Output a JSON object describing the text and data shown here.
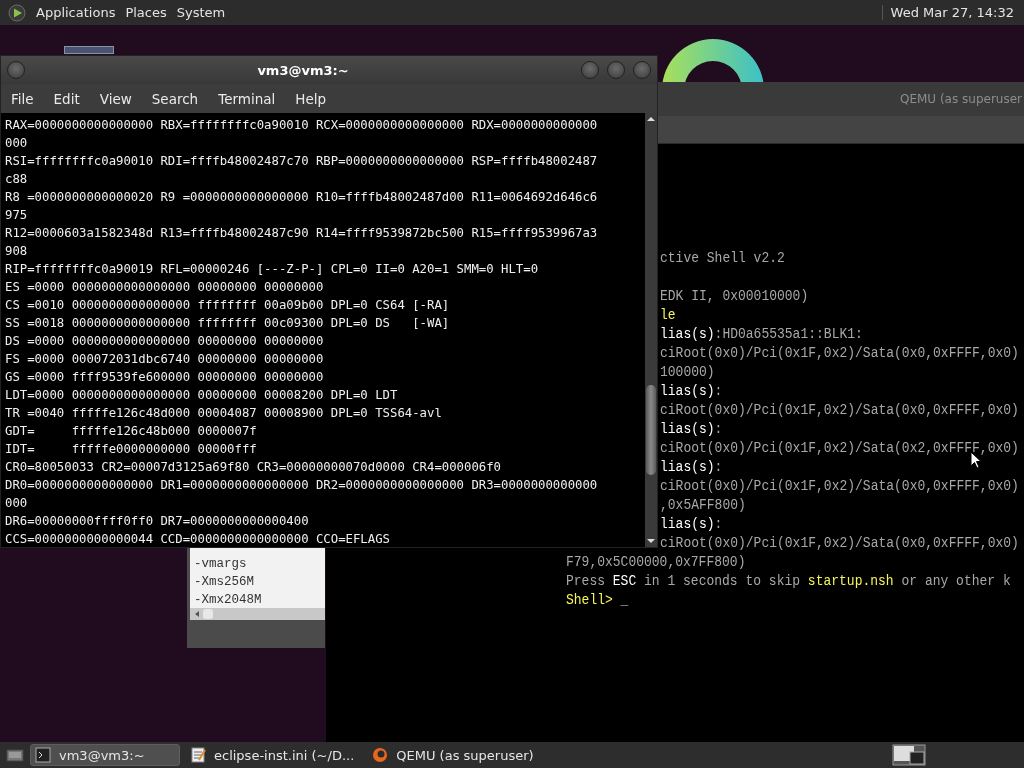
{
  "top_panel": {
    "menus": [
      "Applications",
      "Places",
      "System"
    ],
    "clock": "Wed Mar 27, 14:32"
  },
  "terminal_window": {
    "title": "vm3@vm3:~",
    "menu": [
      "File",
      "Edit",
      "View",
      "Search",
      "Terminal",
      "Help"
    ],
    "lines": [
      "RAX=0000000000000000 RBX=ffffffffc0a90010 RCX=0000000000000000 RDX=0000000000000",
      "000",
      "RSI=ffffffffc0a90010 RDI=ffffb48002487c70 RBP=0000000000000000 RSP=ffffb48002487",
      "c88",
      "R8 =0000000000000020 R9 =0000000000000000 R10=ffffb48002487d00 R11=0064692d646c6",
      "975",
      "R12=0000603a1582348d R13=ffffb48002487c90 R14=ffff9539872bc500 R15=ffff9539967a3",
      "908",
      "RIP=ffffffffc0a90019 RFL=00000246 [---Z-P-] CPL=0 II=0 A20=1 SMM=0 HLT=0",
      "ES =0000 0000000000000000 00000000 00000000",
      "CS =0010 0000000000000000 ffffffff 00a09b00 DPL=0 CS64 [-RA]",
      "SS =0018 0000000000000000 ffffffff 00c09300 DPL=0 DS   [-WA]",
      "DS =0000 0000000000000000 00000000 00000000",
      "FS =0000 000072031dbc6740 00000000 00000000",
      "GS =0000 ffff9539fe600000 00000000 00000000",
      "LDT=0000 0000000000000000 00000000 00008200 DPL=0 LDT",
      "TR =0040 fffffe126c48d000 00004087 00008900 DPL=0 TSS64-avl",
      "GDT=     fffffe126c48b000 0000007f",
      "IDT=     fffffe0000000000 00000fff",
      "CR0=80050033 CR2=00007d3125a69f80 CR3=00000000070d0000 CR4=000006f0",
      "DR0=0000000000000000 DR1=0000000000000000 DR2=0000000000000000 DR3=0000000000000",
      "000",
      "DR6=00000000ffff0ff0 DR7=0000000000000400",
      "CCS=0000000000000044 CCD=0000000000000000 CCO=EFLAGS"
    ]
  },
  "qemu_window": {
    "title": "QEMU (as superuser",
    "lines": [
      {
        "kind": "partial",
        "segments": [
          {
            "kind": "plain",
            "text": "ctive Shell v2.2"
          }
        ]
      },
      {
        "kind": "blank"
      },
      {
        "kind": "partial",
        "segments": [
          {
            "kind": "plain",
            "text": "EDK II, 0x00010000)"
          }
        ]
      },
      {
        "kind": "partial",
        "segments": [
          {
            "kind": "yellow",
            "text": "le"
          }
        ]
      },
      {
        "kind": "partial",
        "segments": [
          {
            "kind": "bright",
            "text": "lias(s)"
          },
          {
            "kind": "plain",
            "text": ":HD0a65535a1::BLK1:"
          }
        ]
      },
      {
        "kind": "partial",
        "segments": [
          {
            "kind": "plain",
            "text": "ciRoot(0x0)/Pci(0x1F,0x2)/Sata(0x0,0xFFFF,0x0)"
          }
        ]
      },
      {
        "kind": "partial",
        "segments": [
          {
            "kind": "plain",
            "text": "100000)"
          }
        ]
      },
      {
        "kind": "partial",
        "segments": [
          {
            "kind": "bright",
            "text": "lias(s)"
          },
          {
            "kind": "plain",
            "text": ":"
          }
        ]
      },
      {
        "kind": "partial",
        "segments": [
          {
            "kind": "plain",
            "text": "ciRoot(0x0)/Pci(0x1F,0x2)/Sata(0x0,0xFFFF,0x0)"
          }
        ]
      },
      {
        "kind": "partial",
        "segments": [
          {
            "kind": "bright",
            "text": "lias(s)"
          },
          {
            "kind": "plain",
            "text": ":"
          }
        ]
      },
      {
        "kind": "partial",
        "segments": [
          {
            "kind": "plain",
            "text": "ciRoot(0x0)/Pci(0x1F,0x2)/Sata(0x2,0xFFFF,0x0)"
          }
        ]
      },
      {
        "kind": "partial",
        "segments": [
          {
            "kind": "bright",
            "text": "lias(s)"
          },
          {
            "kind": "plain",
            "text": ":"
          }
        ]
      },
      {
        "kind": "partial",
        "segments": [
          {
            "kind": "plain",
            "text": "ciRoot(0x0)/Pci(0x1F,0x2)/Sata(0x0,0xFFFF,0x0)"
          }
        ]
      },
      {
        "kind": "partial",
        "segments": [
          {
            "kind": "plain",
            "text": ",0x5AFF800)"
          }
        ]
      },
      {
        "kind": "partial",
        "segments": [
          {
            "kind": "bright",
            "text": "lias(s)"
          },
          {
            "kind": "plain",
            "text": ":"
          }
        ]
      },
      {
        "kind": "partial",
        "segments": [
          {
            "kind": "plain",
            "text": "ciRoot(0x0)/Pci(0x1F,0x2)/Sata(0x0,0xFFFF,0x0)"
          }
        ]
      },
      {
        "kind": "full",
        "segments": [
          {
            "kind": "plain",
            "text": "F79,0x5C00000,0x7FF800)"
          }
        ]
      },
      {
        "kind": "full",
        "segments": [
          {
            "kind": "plain",
            "text": "Press "
          },
          {
            "kind": "bright",
            "text": "ESC"
          },
          {
            "kind": "plain",
            "text": " in 1 seconds to skip "
          },
          {
            "kind": "yellow",
            "text": "startup.nsh"
          },
          {
            "kind": "plain",
            "text": " or any other k"
          }
        ]
      },
      {
        "kind": "full",
        "segments": [
          {
            "kind": "yellow",
            "text": "Shell>"
          },
          {
            "kind": "plain",
            "text": " _"
          }
        ]
      }
    ]
  },
  "editor_window": {
    "lines": [
      "-vmargs",
      "-Xms256M",
      "-Xmx2048M"
    ]
  },
  "taskbar": {
    "tasks": [
      {
        "kind": "terminal",
        "label": "vm3@vm3:~",
        "selected": true
      },
      {
        "kind": "editor",
        "label": "eclipse-inst.ini (~/D...",
        "selected": false
      },
      {
        "kind": "emulator",
        "label": "QEMU (as superuser)",
        "selected": false
      }
    ]
  }
}
